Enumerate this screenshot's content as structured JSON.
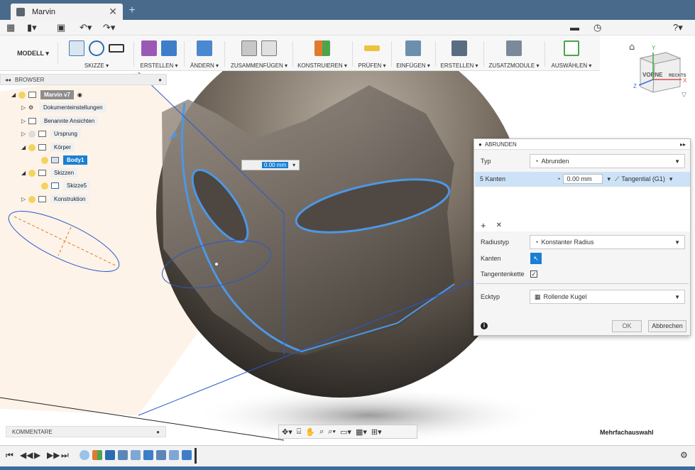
{
  "document": {
    "tab_title": "Marvin"
  },
  "ribbon": {
    "workspace": "MODELL ▾",
    "groups": [
      {
        "label": "SKIZZE ▾"
      },
      {
        "label": "ERSTELLEN ▾"
      },
      {
        "label": "ÄNDERN ▾"
      },
      {
        "label": "ZUSAMMENFÜGEN ▾"
      },
      {
        "label": "KONSTRUIEREN ▾"
      },
      {
        "label": "PRÜFEN ▾"
      },
      {
        "label": "EINFÜGEN ▾"
      },
      {
        "label": "ERSTELLEN ▾"
      },
      {
        "label": "ZUSATZMODULE ▾"
      },
      {
        "label": "AUSWÄHLEN ▾"
      }
    ]
  },
  "viewcube": {
    "face_label": "VORNE",
    "side_label": "RECHTS",
    "axes": {
      "x": "X",
      "y": "Y",
      "z": "Z"
    }
  },
  "browser": {
    "title": "BROWSER",
    "items": [
      {
        "label": "Marvin v7"
      },
      {
        "label": "Dokumenteinstellungen"
      },
      {
        "label": "Benannte Ansichten"
      },
      {
        "label": "Ursprung"
      },
      {
        "label": "Körper"
      },
      {
        "label": "Body1"
      },
      {
        "label": "Skizzen"
      },
      {
        "label": "Skizze5"
      },
      {
        "label": "Konstruktion"
      }
    ]
  },
  "canvas": {
    "distance_value": "0.00 mm"
  },
  "dialog": {
    "title": "ABRUNDEN",
    "type_label": "Typ",
    "type_value": "Abrunden",
    "edges_label": "5 Kanten",
    "radius_value": "0.00 mm",
    "continuity": "Tangential (G1)",
    "radius_type_label": "Radiustyp",
    "radius_type_value": "Konstanter Radius",
    "edges_sel_label": "Kanten",
    "tangent_chain_label": "Tangentenkette",
    "corner_type_label": "Ecktyp",
    "corner_type_value": "Rollende Kugel",
    "ok_label": "OK",
    "cancel_label": "Abbrechen",
    "add_symbol": "+",
    "remove_symbol": "✕"
  },
  "comments": {
    "label": "KOMMENTARE"
  },
  "status": {
    "selection_mode": "Mehrfachauswahl"
  },
  "colors": {
    "accent": "#1a7fd4",
    "titlebar": "#4a6a8c",
    "edge_highlight": "#4d97e6"
  }
}
